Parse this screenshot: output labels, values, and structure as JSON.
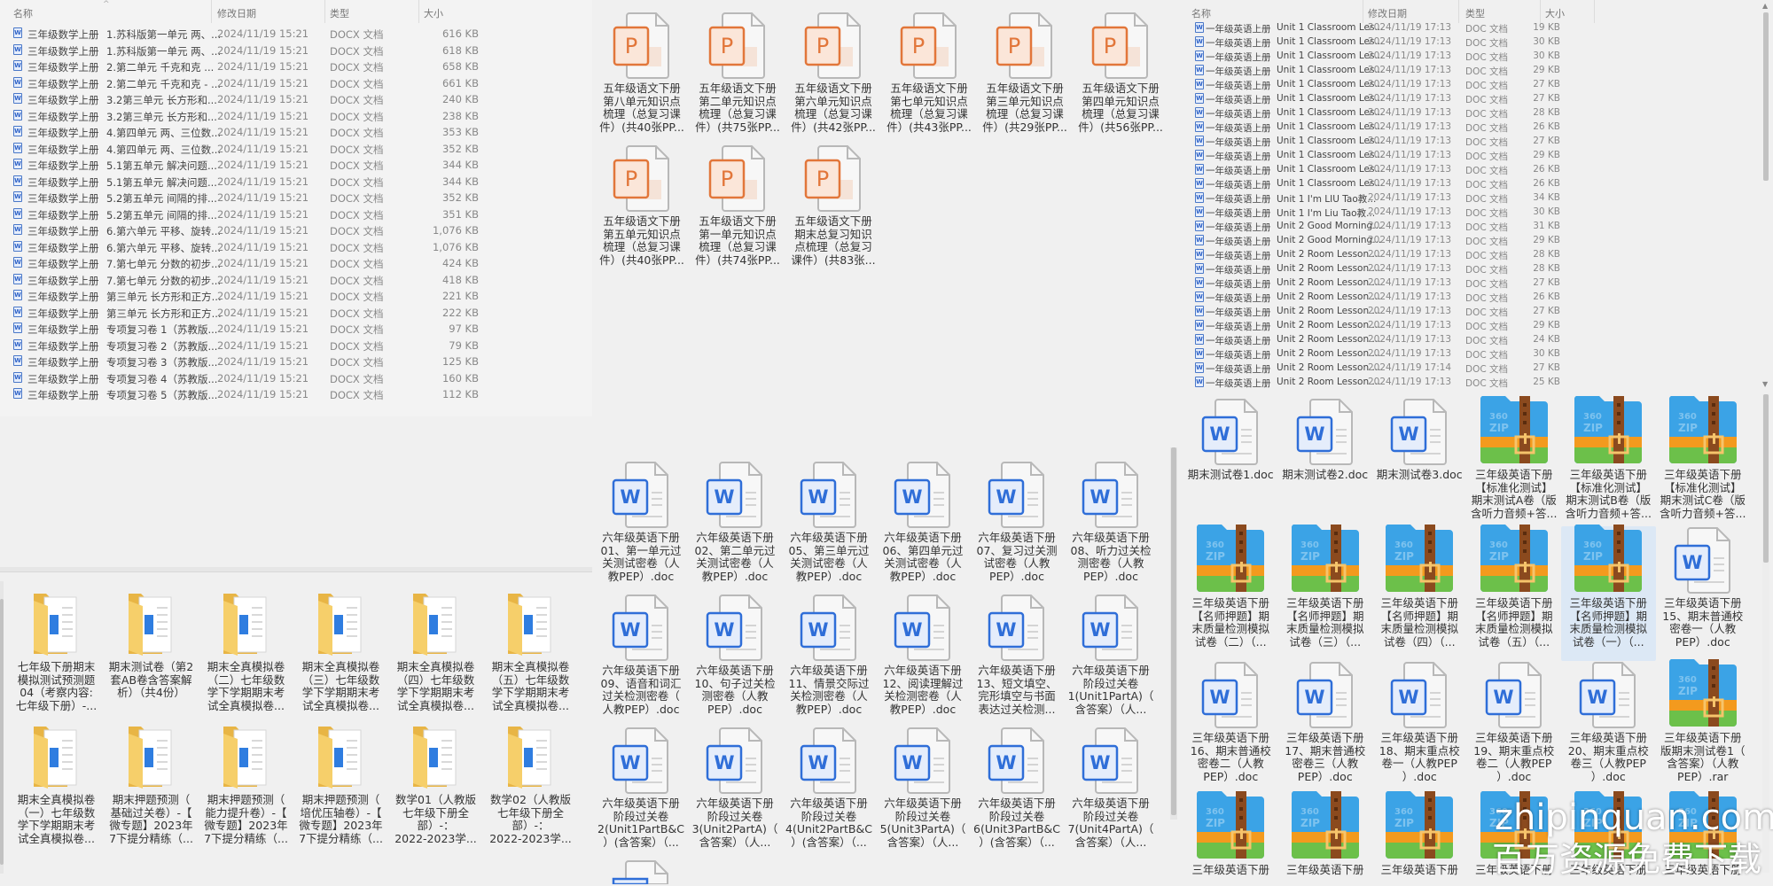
{
  "colors": {
    "accent": "#2f6ed8",
    "ppt": "#e2763a",
    "folder": "#f4c85a",
    "selected": "#dce8f5"
  },
  "panel_a": {
    "headers": {
      "name": "名称",
      "date": "修改日期",
      "type": "类型",
      "size": "大小"
    },
    "rows": [
      {
        "prefix": "三年级数学上册",
        "name": "1.苏科版第一单元 两、...",
        "date": "2024/11/19 15:21",
        "type": "DOCX 文档",
        "size": "616 KB"
      },
      {
        "prefix": "三年级数学上册",
        "name": "1.苏科版第一单元 两、...",
        "date": "2024/11/19 15:21",
        "type": "DOCX 文档",
        "size": "618 KB"
      },
      {
        "prefix": "三年级数学上册",
        "name": "2.第二单元 千克和克 ...",
        "date": "2024/11/19 15:21",
        "type": "DOCX 文档",
        "size": "658 KB"
      },
      {
        "prefix": "三年级数学上册",
        "name": "2.第二单元 千克和克 - ...",
        "date": "2024/11/19 15:21",
        "type": "DOCX 文档",
        "size": "661 KB"
      },
      {
        "prefix": "三年级数学上册",
        "name": "3.2第三单元 长方形和...",
        "date": "2024/11/19 15:21",
        "type": "DOCX 文档",
        "size": "240 KB"
      },
      {
        "prefix": "三年级数学上册",
        "name": "3.2第三单元 长方形和...",
        "date": "2024/11/19 15:21",
        "type": "DOCX 文档",
        "size": "238 KB"
      },
      {
        "prefix": "三年级数学上册",
        "name": "4.第四单元 两、三位数...",
        "date": "2024/11/19 15:21",
        "type": "DOCX 文档",
        "size": "353 KB"
      },
      {
        "prefix": "三年级数学上册",
        "name": "4.第四单元 两、三位数...",
        "date": "2024/11/19 15:21",
        "type": "DOCX 文档",
        "size": "352 KB"
      },
      {
        "prefix": "三年级数学上册",
        "name": "5.1第五单元 解决问题...",
        "date": "2024/11/19 15:21",
        "type": "DOCX 文档",
        "size": "344 KB"
      },
      {
        "prefix": "三年级数学上册",
        "name": "5.1第五单元 解决问题...",
        "date": "2024/11/19 15:21",
        "type": "DOCX 文档",
        "size": "344 KB"
      },
      {
        "prefix": "三年级数学上册",
        "name": "5.2第五单元 间隔的排...",
        "date": "2024/11/19 15:21",
        "type": "DOCX 文档",
        "size": "352 KB"
      },
      {
        "prefix": "三年级数学上册",
        "name": "5.2第五单元 间隔的排...",
        "date": "2024/11/19 15:21",
        "type": "DOCX 文档",
        "size": "351 KB"
      },
      {
        "prefix": "三年级数学上册",
        "name": "6.第六单元 平移、旋转...",
        "date": "2024/11/19 15:21",
        "type": "DOCX 文档",
        "size": "1,076 KB"
      },
      {
        "prefix": "三年级数学上册",
        "name": "6.第六单元 平移、旋转...",
        "date": "2024/11/19 15:21",
        "type": "DOCX 文档",
        "size": "1,076 KB"
      },
      {
        "prefix": "三年级数学上册",
        "name": "7.第七单元 分数的初步...",
        "date": "2024/11/19 15:21",
        "type": "DOCX 文档",
        "size": "424 KB"
      },
      {
        "prefix": "三年级数学上册",
        "name": "7.第七单元 分数的初步...",
        "date": "2024/11/19 15:21",
        "type": "DOCX 文档",
        "size": "418 KB"
      },
      {
        "prefix": "三年级数学上册",
        "name": "第三单元 长方形和正方...",
        "date": "2024/11/19 15:21",
        "type": "DOCX 文档",
        "size": "221 KB"
      },
      {
        "prefix": "三年级数学上册",
        "name": "第三单元 长方形和正方...",
        "date": "2024/11/19 15:21",
        "type": "DOCX 文档",
        "size": "222 KB"
      },
      {
        "prefix": "三年级数学上册",
        "name": "专项复习卷 1（苏教版...",
        "date": "2024/11/19 15:21",
        "type": "DOCX 文档",
        "size": "97 KB"
      },
      {
        "prefix": "三年级数学上册",
        "name": "专项复习卷 2（苏教版...",
        "date": "2024/11/19 15:21",
        "type": "DOCX 文档",
        "size": "79 KB"
      },
      {
        "prefix": "三年级数学上册",
        "name": "专项复习卷 3（苏教版...",
        "date": "2024/11/19 15:21",
        "type": "DOCX 文档",
        "size": "125 KB"
      },
      {
        "prefix": "三年级数学上册",
        "name": "专项复习卷 4（苏教版...",
        "date": "2024/11/19 15:21",
        "type": "DOCX 文档",
        "size": "160 KB"
      },
      {
        "prefix": "三年级数学上册",
        "name": "专项复习卷 5（苏教版...",
        "date": "2024/11/19 15:21",
        "type": "DOCX 文档",
        "size": "112 KB"
      }
    ]
  },
  "panel_b": {
    "items": [
      {
        "icon": "ppt",
        "lines": [
          "五年级语文下册",
          "第八单元知识点",
          "梳理（总复习课",
          "件）(共40张PP..."
        ]
      },
      {
        "icon": "ppt",
        "lines": [
          "五年级语文下册",
          "第二单元知识点",
          "梳理（总复习课",
          "件）(共75张PP..."
        ]
      },
      {
        "icon": "ppt",
        "lines": [
          "五年级语文下册",
          "第六单元知识点",
          "梳理（总复习课",
          "件）(共42张PP..."
        ]
      },
      {
        "icon": "ppt",
        "lines": [
          "五年级语文下册",
          "第七单元知识点",
          "梳理（总复习课",
          "件）(共43张PP..."
        ]
      },
      {
        "icon": "ppt",
        "lines": [
          "五年级语文下册",
          "第三单元知识点",
          "梳理（总复习课",
          "件）(共29张PP..."
        ]
      },
      {
        "icon": "ppt",
        "lines": [
          "五年级语文下册",
          "第四单元知识点",
          "梳理（总复习课",
          "件）(共56张PP..."
        ]
      },
      {
        "icon": "ppt",
        "lines": [
          "五年级语文下册",
          "第五单元知识点",
          "梳理（总复习课",
          "件）(共40张PP..."
        ]
      },
      {
        "icon": "ppt",
        "lines": [
          "五年级语文下册",
          "第一单元知识点",
          "梳理（总复习课",
          "件）(共74张PP..."
        ]
      },
      {
        "icon": "ppt",
        "lines": [
          "五年级语文下册",
          "期末总复习知识",
          "点梳理（总复习",
          "课件）(共83张..."
        ]
      }
    ]
  },
  "panel_c": {
    "items": [
      {
        "icon": "folder",
        "lines": [
          "七年级下册期末",
          "模拟测试预测题",
          "04（考察内容:",
          "七年级下册）-..."
        ]
      },
      {
        "icon": "folder",
        "lines": [
          "期末测试卷（第2",
          "套AB卷含答案解",
          "析）（共4份）"
        ]
      },
      {
        "icon": "folder",
        "lines": [
          "期末全真模拟卷",
          "（二）七年级数",
          "学下学期期末考",
          "试全真模拟卷..."
        ]
      },
      {
        "icon": "folder",
        "lines": [
          "期末全真模拟卷",
          "（三）七年级数",
          "学下学期期末考",
          "试全真模拟卷..."
        ]
      },
      {
        "icon": "folder",
        "lines": [
          "期末全真模拟卷",
          "（四）七年级数",
          "学下学期期末考",
          "试全真模拟卷..."
        ]
      },
      {
        "icon": "folder",
        "lines": [
          "期末全真模拟卷",
          "（五）七年级数",
          "学下学期期末考",
          "试全真模拟卷..."
        ]
      },
      {
        "icon": "folder",
        "lines": [
          "期末全真模拟卷",
          "（一）七年级数",
          "学下学期期末考",
          "试全真模拟卷..."
        ]
      },
      {
        "icon": "folder",
        "lines": [
          "期末押题预测（",
          "基础过关卷）-【",
          "微专题】2023年",
          "7下提分精练（..."
        ]
      },
      {
        "icon": "folder",
        "lines": [
          "期末押题预测（",
          "能力提升卷）-【",
          "微专题】2023年",
          "7下提分精练（..."
        ]
      },
      {
        "icon": "folder",
        "lines": [
          "期末押题预测（",
          "培优压轴卷）-【",
          "微专题】2023年",
          "7下提分精练（..."
        ]
      },
      {
        "icon": "folder",
        "lines": [
          "数学01（人教版",
          "七年级下册全",
          "部）-：",
          "2022-2023学..."
        ]
      },
      {
        "icon": "folder",
        "lines": [
          "数学02（人教版",
          "七年级下册全",
          "部）-：",
          "2022-2023学..."
        ]
      }
    ]
  },
  "panel_d": {
    "items": [
      {
        "icon": "word",
        "lines": [
          "六年级英语下册",
          "01、第一单元过",
          "关测试密卷（人",
          "教PEP）.doc"
        ]
      },
      {
        "icon": "word",
        "lines": [
          "六年级英语下册",
          "02、第二单元过",
          "关测试密卷（人",
          "教PEP）.doc"
        ]
      },
      {
        "icon": "word",
        "lines": [
          "六年级英语下册",
          "05、第三单元过",
          "关测试密卷（人",
          "教PEP）.doc"
        ]
      },
      {
        "icon": "word",
        "lines": [
          "六年级英语下册",
          "06、第四单元过",
          "关测试密卷（人",
          "教PEP）.doc"
        ]
      },
      {
        "icon": "word",
        "lines": [
          "六年级英语下册",
          "07、复习过关测",
          "试密卷（人教",
          "PEP）.doc"
        ]
      },
      {
        "icon": "word",
        "lines": [
          "六年级英语下册",
          "08、听力过关检",
          "测密卷（人教",
          "PEP）.doc"
        ]
      },
      {
        "icon": "word",
        "lines": [
          "六年级英语下册",
          "09、语音和词汇",
          "过关检测密卷（",
          "人教PEP）.doc"
        ]
      },
      {
        "icon": "word",
        "lines": [
          "六年级英语下册",
          "10、句子过关检",
          "测密卷（人教",
          "PEP）.doc"
        ]
      },
      {
        "icon": "word",
        "lines": [
          "六年级英语下册",
          "11、情景交际过",
          "关检测密卷（人",
          "教PEP）.doc"
        ]
      },
      {
        "icon": "word",
        "lines": [
          "六年级英语下册",
          "12、阅读理解过",
          "关检测密卷（人",
          "教PEP）.doc"
        ]
      },
      {
        "icon": "word",
        "lines": [
          "六年级英语下册",
          "13、短文填空、",
          "完形填空与书面",
          "表达过关检测..."
        ]
      },
      {
        "icon": "word",
        "lines": [
          "六年级英语下册",
          "阶段过关卷",
          "1(Unit1PartA)（",
          "含答案）（人..."
        ]
      },
      {
        "icon": "word",
        "lines": [
          "六年级英语下册",
          "阶段过关卷",
          "2(Unit1PartB&C",
          "）(含答案）（..."
        ]
      },
      {
        "icon": "word",
        "lines": [
          "六年级英语下册",
          "阶段过关卷",
          "3(Unit2PartA)（",
          "含答案）（人..."
        ]
      },
      {
        "icon": "word",
        "lines": [
          "六年级英语下册",
          "阶段过关卷",
          "4(Unit2PartB&C",
          "）(含答案）（..."
        ]
      },
      {
        "icon": "word",
        "lines": [
          "六年级英语下册",
          "阶段过关卷",
          "5(Unit3PartA)（",
          "含答案）（人..."
        ]
      },
      {
        "icon": "word",
        "lines": [
          "六年级英语下册",
          "阶段过关卷",
          "6(Unit3PartB&C",
          "）(含答案）（..."
        ]
      },
      {
        "icon": "word",
        "lines": [
          "六年级英语下册",
          "阶段过关卷",
          "7(Unit4PartA)（",
          "含答案）（人..."
        ]
      },
      {
        "icon": "word",
        "lines": []
      }
    ]
  },
  "panel_e": {
    "headers": {
      "name": "名称",
      "date": "修改日期",
      "type": "类型",
      "size": "大小"
    },
    "rows": [
      {
        "prefix": "一年级英语上册",
        "name": "Unit 1 Classroom Les...",
        "date": "2024/11/19 17:13",
        "type": "DOC 文档",
        "size": "19 KB"
      },
      {
        "prefix": "一年级英语上册",
        "name": "Unit 1 Classroom Les...",
        "date": "2024/11/19 17:13",
        "type": "DOC 文档",
        "size": "30 KB"
      },
      {
        "prefix": "一年级英语上册",
        "name": "Unit 1 Classroom Les...",
        "date": "2024/11/19 17:13",
        "type": "DOC 文档",
        "size": "30 KB"
      },
      {
        "prefix": "一年级英语上册",
        "name": "Unit 1 Classroom Les...",
        "date": "2024/11/19 17:13",
        "type": "DOC 文档",
        "size": "29 KB"
      },
      {
        "prefix": "一年级英语上册",
        "name": "Unit 1 Classroom Les...",
        "date": "2024/11/19 17:13",
        "type": "DOC 文档",
        "size": "27 KB"
      },
      {
        "prefix": "一年级英语上册",
        "name": "Unit 1 Classroom Les...",
        "date": "2024/11/19 17:13",
        "type": "DOC 文档",
        "size": "27 KB"
      },
      {
        "prefix": "一年级英语上册",
        "name": "Unit 1 Classroom Les...",
        "date": "2024/11/19 17:13",
        "type": "DOC 文档",
        "size": "28 KB"
      },
      {
        "prefix": "一年级英语上册",
        "name": "Unit 1 Classroom Les...",
        "date": "2024/11/19 17:13",
        "type": "DOC 文档",
        "size": "26 KB"
      },
      {
        "prefix": "一年级英语上册",
        "name": "Unit 1 Classroom Les...",
        "date": "2024/11/19 17:13",
        "type": "DOC 文档",
        "size": "27 KB"
      },
      {
        "prefix": "一年级英语上册",
        "name": "Unit 1 Classroom Les...",
        "date": "2024/11/19 17:13",
        "type": "DOC 文档",
        "size": "29 KB"
      },
      {
        "prefix": "一年级英语上册",
        "name": "Unit 1 Classroom Les...",
        "date": "2024/11/19 17:13",
        "type": "DOC 文档",
        "size": "26 KB"
      },
      {
        "prefix": "一年级英语上册",
        "name": "Unit 1 Classroom Les...",
        "date": "2024/11/19 17:13",
        "type": "DOC 文档",
        "size": "26 KB"
      },
      {
        "prefix": "一年级英语上册",
        "name": "Unit 1 I'm LIU Tao教...",
        "date": "2024/11/19 17:13",
        "type": "DOC 文档",
        "size": "34 KB"
      },
      {
        "prefix": "一年级英语上册",
        "name": "Unit 1 I'm Liu Tao教...",
        "date": "2024/11/19 17:13",
        "type": "DOC 文档",
        "size": "30 KB"
      },
      {
        "prefix": "一年级英语上册",
        "name": "Unit 2 Good Morning...",
        "date": "2024/11/19 17:13",
        "type": "DOC 文档",
        "size": "31 KB"
      },
      {
        "prefix": "一年级英语上册",
        "name": "Unit 2 Good Morning...",
        "date": "2024/11/19 17:13",
        "type": "DOC 文档",
        "size": "29 KB"
      },
      {
        "prefix": "一年级英语上册",
        "name": "Unit 2 Room Lesson ...",
        "date": "2024/11/19 17:13",
        "type": "DOC 文档",
        "size": "28 KB"
      },
      {
        "prefix": "一年级英语上册",
        "name": "Unit 2 Room Lesson ...",
        "date": "2024/11/19 17:13",
        "type": "DOC 文档",
        "size": "28 KB"
      },
      {
        "prefix": "一年级英语上册",
        "name": "Unit 2 Room Lesson ...",
        "date": "2024/11/19 17:13",
        "type": "DOC 文档",
        "size": "27 KB"
      },
      {
        "prefix": "一年级英语上册",
        "name": "Unit 2 Room Lesson ...",
        "date": "2024/11/19 17:13",
        "type": "DOC 文档",
        "size": "26 KB"
      },
      {
        "prefix": "一年级英语上册",
        "name": "Unit 2 Room Lesson ...",
        "date": "2024/11/19 17:13",
        "type": "DOC 文档",
        "size": "27 KB"
      },
      {
        "prefix": "一年级英语上册",
        "name": "Unit 2 Room Lesson ...",
        "date": "2024/11/19 17:13",
        "type": "DOC 文档",
        "size": "29 KB"
      },
      {
        "prefix": "一年级英语上册",
        "name": "Unit 2 Room Lesson ...",
        "date": "2024/11/19 17:13",
        "type": "DOC 文档",
        "size": "24 KB"
      },
      {
        "prefix": "一年级英语上册",
        "name": "Unit 2 Room Lesson ...",
        "date": "2024/11/19 17:13",
        "type": "DOC 文档",
        "size": "30 KB"
      },
      {
        "prefix": "一年级英语上册",
        "name": "Unit 2 Room Lesson ...",
        "date": "2024/11/19 17:14",
        "type": "DOC 文档",
        "size": "27 KB"
      },
      {
        "prefix": "一年级英语上册",
        "name": "Unit 2 Room Lesson ...",
        "date": "2024/11/19 17:13",
        "type": "DOC 文档",
        "size": "25 KB"
      }
    ]
  },
  "panel_f": {
    "items": [
      {
        "icon": "word",
        "lines": [
          "期末测试卷1.doc"
        ]
      },
      {
        "icon": "word",
        "lines": [
          "期末测试卷2.doc"
        ]
      },
      {
        "icon": "word",
        "lines": [
          "期末测试卷3.doc"
        ]
      },
      {
        "icon": "zip",
        "lines": [
          "三年级英语下册",
          "【标准化测试】",
          "期末测试A卷（版",
          "含听力音频+答..."
        ]
      },
      {
        "icon": "zip",
        "lines": [
          "三年级英语下册",
          "【标准化测试】",
          "期末测试B卷（版",
          "含听力音频+答..."
        ]
      },
      {
        "icon": "zip",
        "lines": [
          "三年级英语下册",
          "【标准化测试】",
          "期末测试C卷（版",
          "含听力音频+答..."
        ]
      },
      {
        "icon": "zip",
        "lines": [
          "三年级英语下册",
          "【名师押题】期",
          "末质量检测模拟",
          "试卷（二）（..."
        ]
      },
      {
        "icon": "zip",
        "lines": [
          "三年级英语下册",
          "【名师押题】期",
          "末质量检测模拟",
          "试卷（三）（..."
        ]
      },
      {
        "icon": "zip",
        "lines": [
          "三年级英语下册",
          "【名师押题】期",
          "末质量检测模拟",
          "试卷（四）（..."
        ]
      },
      {
        "icon": "zip",
        "lines": [
          "三年级英语下册",
          "【名师押题】期",
          "末质量检测模拟",
          "试卷（五）（..."
        ]
      },
      {
        "icon": "zip",
        "selected": true,
        "lines": [
          "三年级英语下册",
          "【名师押题】期",
          "末质量检测模拟",
          "试卷（一）（..."
        ]
      },
      {
        "icon": "word",
        "lines": [
          "三年级英语下册",
          "15、期末普通校",
          "密卷一（人教",
          "PEP）.doc"
        ]
      },
      {
        "icon": "word",
        "lines": [
          "三年级英语下册",
          "16、期末普通校",
          "密卷二（人教",
          "PEP）.doc"
        ]
      },
      {
        "icon": "word",
        "lines": [
          "三年级英语下册",
          "17、期末普通校",
          "密卷三（人教",
          "PEP）.doc"
        ]
      },
      {
        "icon": "word",
        "lines": [
          "三年级英语下册",
          "18、期末重点校",
          "卷一（人教PEP",
          "）.doc"
        ]
      },
      {
        "icon": "word",
        "lines": [
          "三年级英语下册",
          "19、期末重点校",
          "卷二（人教PEP",
          "）.doc"
        ]
      },
      {
        "icon": "word",
        "lines": [
          "三年级英语下册",
          "20、期末重点校",
          "卷三（人教PEP",
          "）.doc"
        ]
      },
      {
        "icon": "zip",
        "lines": [
          "三年级英语下册",
          "版期末测试卷1（",
          "含答案）（人教",
          "PEP）.rar"
        ]
      },
      {
        "icon": "zip",
        "lines": [
          "三年级英语下册"
        ]
      },
      {
        "icon": "zip",
        "lines": [
          "三年级英语下册"
        ]
      },
      {
        "icon": "zip",
        "lines": [
          "三年级英语下册"
        ]
      },
      {
        "icon": "zip",
        "lines": [
          "三年级英语下册"
        ]
      },
      {
        "icon": "zip",
        "lines": [
          "三年级英语下册"
        ]
      },
      {
        "icon": "zip",
        "lines": [
          "三年级英语下册"
        ]
      }
    ]
  },
  "watermark": {
    "site": "zhipinquan.com",
    "slogan": "百万资源免费下载"
  }
}
